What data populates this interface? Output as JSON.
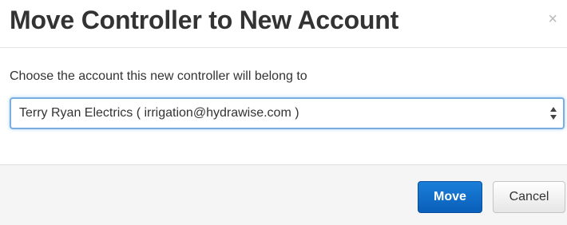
{
  "dialog": {
    "title": "Move Controller to New Account",
    "close_symbol": "×"
  },
  "form": {
    "prompt": "Choose the account this new controller will belong to",
    "account_select": {
      "selected": "Terry Ryan Electrics ( irrigation@hydrawise.com )"
    }
  },
  "footer": {
    "move_label": "Move",
    "cancel_label": "Cancel"
  },
  "colors": {
    "primary_button": "#0a6fd0",
    "focus_border": "#7aaee0",
    "footer_background": "#f5f5f5"
  },
  "icons": {
    "close": "close-icon",
    "select_arrows": "select-arrows-icon"
  }
}
